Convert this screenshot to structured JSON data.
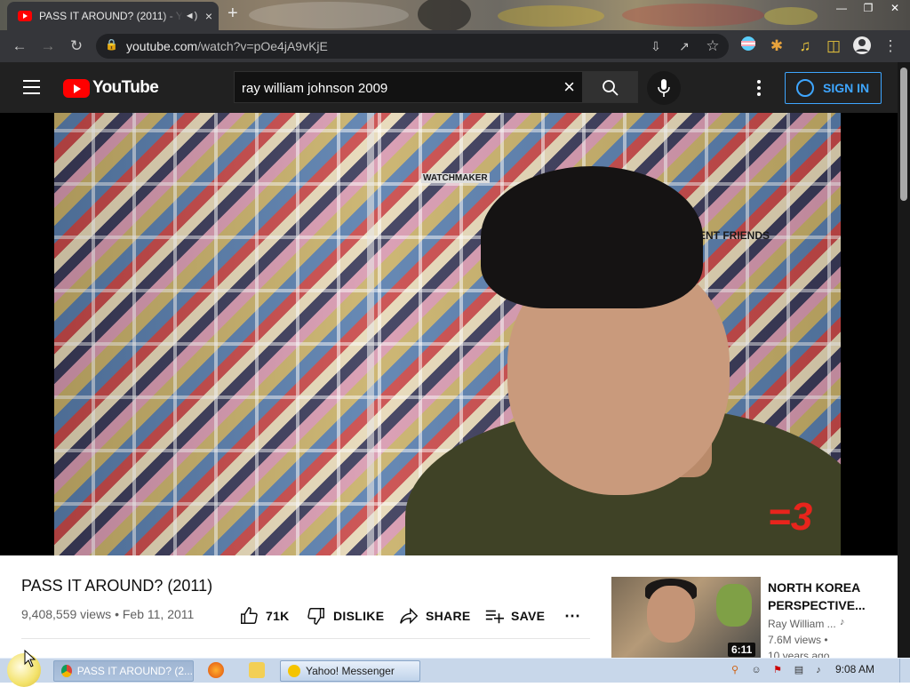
{
  "browser": {
    "tab_title": "PASS IT AROUND? (2011) - YouTube",
    "tab_close": "×",
    "new_tab": "+",
    "url_domain": "youtube.com",
    "url_path": "/watch?v=pOe4jA9vKjE"
  },
  "youtube": {
    "logo_text": "YouTube",
    "search_value": "ray william johnson 2009",
    "search_clear": "×",
    "sign_in": "SIGN IN"
  },
  "video": {
    "title": "PASS IT AROUND? (2011)",
    "views": "9,408,559 views",
    "date": "Feb 11, 2011",
    "meta_sep": " • ",
    "likes": "71K",
    "dislike": "DISLIKE",
    "share": "SHARE",
    "save": "SAVE",
    "overlay_wall_text_1": "WATCHMAKER",
    "overlay_wall_text_2": "SENT FRIENDS",
    "overlay_logo": "=3"
  },
  "recommended": {
    "title_line1": "NORTH KOREA",
    "title_line2": "PERSPECTIVE...",
    "channel": "Ray William ...",
    "views": "7.6M views •",
    "age": "10 years ago",
    "duration": "6:11",
    "music_note": "♪"
  },
  "taskbar": {
    "chrome_window": "PASS IT AROUND? (2...",
    "messenger_window": "Yahoo! Messenger",
    "clock": "9:08 AM"
  },
  "colors": {
    "youtube_red": "#ff0000",
    "masthead_bg": "#212121",
    "signin_blue": "#3ea6ff",
    "taskbar_bg": "#c8d7ea"
  }
}
